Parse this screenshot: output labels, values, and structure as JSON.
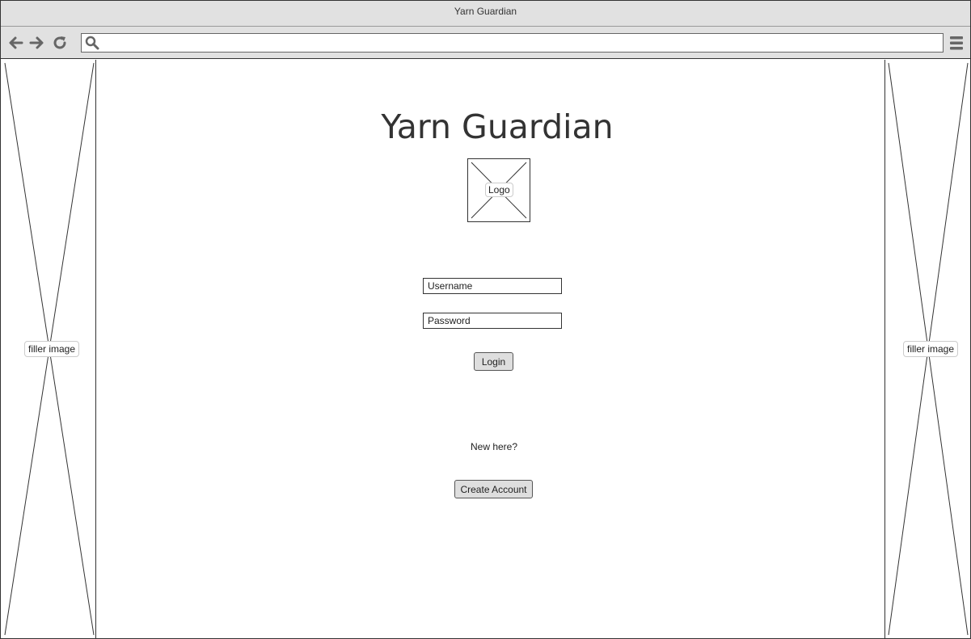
{
  "window": {
    "title": "Yarn Guardian"
  },
  "toolbar": {
    "url_value": "",
    "icons": [
      "back-arrow-icon",
      "forward-arrow-icon",
      "reload-icon",
      "search-icon",
      "hamburger-menu-icon"
    ]
  },
  "sidebar_left": {
    "label": "filler image"
  },
  "sidebar_right": {
    "label": "filler image"
  },
  "main": {
    "title": "Yarn Guardian",
    "logo_label": "Logo",
    "username_placeholder": "Username",
    "password_placeholder": "Password",
    "login_label": "Login",
    "new_here_text": "New here?",
    "create_account_label": "Create Account"
  },
  "colors": {
    "chrome_bg": "#e1e1e1",
    "button_bg": "#dedede",
    "border": "#333333"
  }
}
